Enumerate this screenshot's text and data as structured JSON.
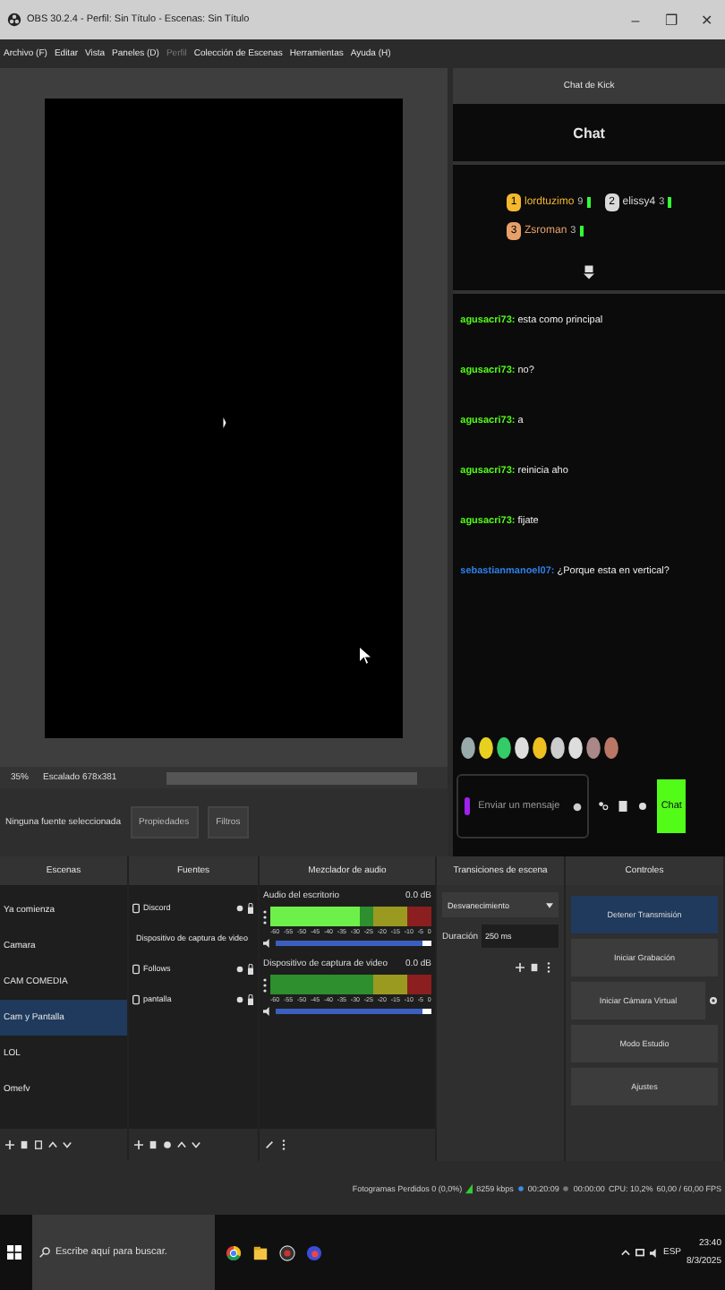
{
  "window": {
    "title": "OBS 30.2.4 - Perfil: Sin Título - Escenas: Sin Título",
    "controls": [
      "–",
      "❐",
      "✕"
    ]
  },
  "menu": [
    {
      "label": "Archivo (F)",
      "disabled": false
    },
    {
      "label": "Editar",
      "disabled": false
    },
    {
      "label": "Vista",
      "disabled": false
    },
    {
      "label": "Paneles (D)",
      "disabled": false
    },
    {
      "label": "Perfil",
      "disabled": true
    },
    {
      "label": "Colección de Escenas",
      "disabled": false
    },
    {
      "label": "Herramientas",
      "disabled": false
    },
    {
      "label": "Ayuda (H)",
      "disabled": false
    }
  ],
  "preview": {
    "zoom": "35%",
    "scale": "Escalado 678x381"
  },
  "source_toolbar": {
    "status": "Ninguna fuente seleccionada",
    "buttons": [
      "Propiedades",
      "Filtros"
    ]
  },
  "chat_dock": {
    "title": "Chat de Kick",
    "heading": "Chat",
    "leaderboard": [
      {
        "rank": "1",
        "name": "lordtuzimo",
        "count": "9"
      },
      {
        "rank": "2",
        "name": "elissy4",
        "count": "3"
      },
      {
        "rank": "3",
        "name": "Zsroman",
        "count": "3"
      }
    ],
    "messages": [
      {
        "user": "agusacri73:",
        "text": "esta como principal",
        "color": "#53fc18"
      },
      {
        "user": "agusacri73:",
        "text": "no?",
        "color": "#53fc18"
      },
      {
        "user": "agusacri73:",
        "text": "a",
        "color": "#53fc18"
      },
      {
        "user": "agusacri73:",
        "text": "reinicia aho",
        "color": "#53fc18"
      },
      {
        "user": "agusacri73:",
        "text": "fijate",
        "color": "#53fc18"
      },
      {
        "user": "sebastianmanoel07:",
        "text": "¿Porque esta en vertical?",
        "color": "#2f7fe8"
      }
    ],
    "input": {
      "placeholder": "Enviar un mensaje"
    },
    "send_button": "Chat"
  },
  "docks": [
    "Escenas",
    "Fuentes",
    "Mezclador de audio",
    "Transiciones de escena",
    "Controles"
  ],
  "scenes": [
    {
      "name": "Ya comienza",
      "selected": false
    },
    {
      "name": "Camara",
      "selected": false
    },
    {
      "name": "CAM COMEDIA",
      "selected": false
    },
    {
      "name": "Cam y Pantalla",
      "selected": true
    },
    {
      "name": "LOL",
      "selected": false
    },
    {
      "name": "Omefv",
      "selected": false
    }
  ],
  "sources": [
    "Discord",
    "Dispositivo de captura de video",
    "Follows",
    "pantalla"
  ],
  "mixer": [
    {
      "name": "Audio del escritorio",
      "reading": "0.0 dB",
      "meter": {
        "level": 0.55
      },
      "volume": {
        "level": 1
      },
      "scale": [
        "-60",
        "-55",
        "-50",
        "-45",
        "-40",
        "-35",
        "-30",
        "-25",
        "-20",
        "-15",
        "-10",
        "-5",
        "0"
      ]
    },
    {
      "name": "Dispositivo de captura de video",
      "reading": "0.0 dB",
      "meter": {
        "level": 0.0
      },
      "volume": {
        "level": 1
      },
      "scale": [
        "-60",
        "-55",
        "-50",
        "-45",
        "-40",
        "-35",
        "-30",
        "-25",
        "-20",
        "-15",
        "-10",
        "-5",
        "0"
      ]
    }
  ],
  "transitions": {
    "transition": "Desvanecimiento",
    "duration_label": "Duración",
    "duration": "250 ms"
  },
  "controls": [
    {
      "label": "Detener Transmisión",
      "active": true
    },
    {
      "label": "Iniciar Grabación",
      "active": false
    },
    {
      "label": "Iniciar Cámara Virtual",
      "active": false
    },
    {
      "label": "Modo Estudio",
      "active": false
    },
    {
      "label": "Ajustes",
      "active": false
    }
  ],
  "status_bar": [
    "Fotogramas Perdidos 0 (0,0%)",
    "8259 kbps",
    "00:20:09",
    "00:00:00",
    "CPU: 10,2%",
    "60,00 / 60,00 FPS"
  ],
  "taskbar": {
    "search_placeholder": "Escribe aquí para buscar.",
    "language": "ESP",
    "time": "23:40",
    "date": "8/3/2025"
  }
}
